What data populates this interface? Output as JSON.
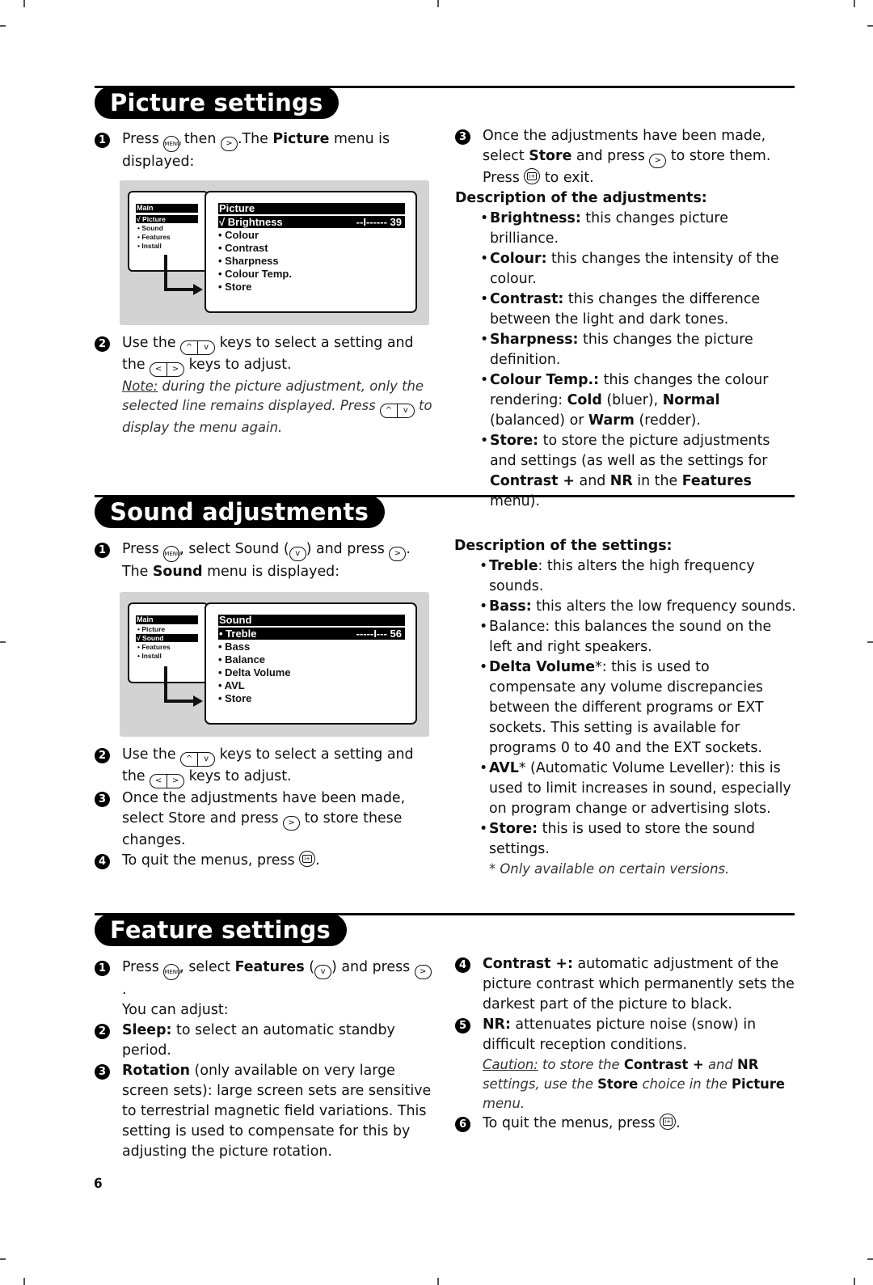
{
  "page_number": "6",
  "picture_settings": {
    "title": "Picture settings",
    "step1": {
      "num": "1",
      "t1": "Press ",
      "t2": " then ",
      "t3": ".The ",
      "bold": "Picture",
      "t4": " menu is displayed:"
    },
    "osd": {
      "main_header": "Main",
      "main_items": [
        {
          "label": "√ Picture",
          "selected": true
        },
        {
          "label": "• Sound",
          "selected": false
        },
        {
          "label": "• Features",
          "selected": false
        },
        {
          "label": "• Install",
          "selected": false
        }
      ],
      "sub_header": "Picture",
      "sub_items": [
        {
          "label": "√ Brightness",
          "value": "--I------ 39",
          "selected": true
        },
        {
          "label": "• Colour"
        },
        {
          "label": "• Contrast"
        },
        {
          "label": "• Sharpness"
        },
        {
          "label": "• Colour Temp."
        },
        {
          "label": "• Store"
        }
      ]
    },
    "step2": {
      "num": "2",
      "t1": "Use the ",
      "t2": " keys to select a setting and the ",
      "t3": " keys to adjust."
    },
    "note": {
      "label": "Note:",
      "t1": " during the picture adjustment, only the selected line remains displayed. Press ",
      "t2": " to display the menu again."
    },
    "step3": {
      "num": "3",
      "t1": "Once the adjustments have been made, select ",
      "bold": "Store",
      "t2": " and press ",
      "t3": " to store them. Press ",
      "t4": " to exit."
    },
    "desc_heading": "Description of the adjustments:",
    "desc": [
      {
        "term": "Brightness:",
        "text": " this changes picture brilliance."
      },
      {
        "term": "Colour:",
        "text": " this changes the intensity of the colour."
      },
      {
        "term": "Contrast:",
        "text": " this changes the difference between the light and dark tones."
      },
      {
        "term": "Sharpness:",
        "text": " this changes the picture definition."
      },
      {
        "term": "Colour Temp.:",
        "text": " this changes the colour rendering: ",
        "b1": "Cold",
        "t1": " (bluer), ",
        "b2": "Normal",
        "t2": " (balanced) or ",
        "b3": "Warm",
        "t3": " (redder)."
      },
      {
        "term": "Store:",
        "text": " to store the picture adjustments and settings (as well as the settings for ",
        "b1": "Contrast +",
        "t1": " and ",
        "b2": "NR",
        "t2": " in the ",
        "b3": "Features",
        "t3": " menu)."
      }
    ]
  },
  "sound_adjustments": {
    "title": "Sound adjustments",
    "step1": {
      "num": "1",
      "t1": "Press ",
      "t2": ", select Sound (",
      "t3": ") and press ",
      "t4": ".",
      "t5": "The ",
      "bold": "Sound",
      "t6": " menu is displayed:"
    },
    "osd": {
      "main_header": "Main",
      "main_items": [
        {
          "label": "• Picture",
          "selected": false
        },
        {
          "label": "√ Sound",
          "selected": true
        },
        {
          "label": "• Features",
          "selected": false
        },
        {
          "label": "• Install",
          "selected": false
        }
      ],
      "sub_header": "Sound",
      "sub_items": [
        {
          "label": "• Treble",
          "value": "-----I--- 56",
          "selected": true
        },
        {
          "label": "• Bass"
        },
        {
          "label": "• Balance"
        },
        {
          "label": "• Delta Volume"
        },
        {
          "label": "• AVL"
        },
        {
          "label": "• Store"
        }
      ]
    },
    "step2": {
      "num": "2",
      "t1": "Use the ",
      "t2": " keys to select a setting and the ",
      "t3": " keys to adjust."
    },
    "step3": {
      "num": "3",
      "t1": "Once the adjustments have been made, select Store and press ",
      "t2": " to store these changes."
    },
    "step4": {
      "num": "4",
      "t1": "To quit the menus, press ",
      "t2": "."
    },
    "desc_heading": "Description of the settings:",
    "desc": [
      {
        "term": "Treble",
        "text": ": this alters the high frequency sounds."
      },
      {
        "term": "Bass:",
        "text": " this alters the low frequency sounds."
      },
      {
        "term": "",
        "text": "Balance: this balances the sound on the left and right speakers."
      },
      {
        "term": "Delta Volume",
        "star": "*",
        "text": ": this is used to compensate any volume discrepancies between the different programs or EXT sockets. This setting is available for programs 0 to 40 and the EXT sockets."
      },
      {
        "term": "AVL",
        "star": "*",
        "text": " (Automatic Volume Leveller): this is used to limit increases in sound, especially on program change or advertising slots."
      },
      {
        "term": "Store:",
        "text": " this is used to store the sound settings."
      }
    ],
    "footnote": "* Only available on certain versions."
  },
  "feature_settings": {
    "title": "Feature settings",
    "step1": {
      "num": "1",
      "t1": "Press ",
      "t2": ", select ",
      "bold": "Features",
      "t3": " (",
      "t4": ") and press ",
      "t5": ".",
      "t6": "You can adjust:"
    },
    "step2": {
      "num": "2",
      "bold": "Sleep:",
      "text": " to select an automatic standby period."
    },
    "step3": {
      "num": "3",
      "bold": "Rotation",
      "text": " (only available on very large screen sets): large screen sets are sensitive to terrestrial magnetic field variations. This setting is used to compensate for this by adjusting the picture rotation."
    },
    "step4": {
      "num": "4",
      "bold": "Contrast +:",
      "text": " automatic adjustment of the picture contrast which permanently sets the darkest part of the picture to black."
    },
    "step5": {
      "num": "5",
      "bold": "NR:",
      "text": " attenuates picture noise (snow) in difficult reception conditions."
    },
    "caution": {
      "label": "Caution:",
      "t1": " to store the ",
      "b1": "Contrast +",
      "t2": " and ",
      "b2": "NR",
      "t3": " settings, use the ",
      "b3": "Store",
      "t4": " choice in the ",
      "b4": "Picture",
      "t5": " menu."
    },
    "step6": {
      "num": "6",
      "t1": "To quit the menus, press ",
      "t2": "."
    }
  },
  "keys": {
    "menu": "MENU",
    "up": "^",
    "down": "v",
    "left": "<",
    "right": ">",
    "info": "i+"
  }
}
